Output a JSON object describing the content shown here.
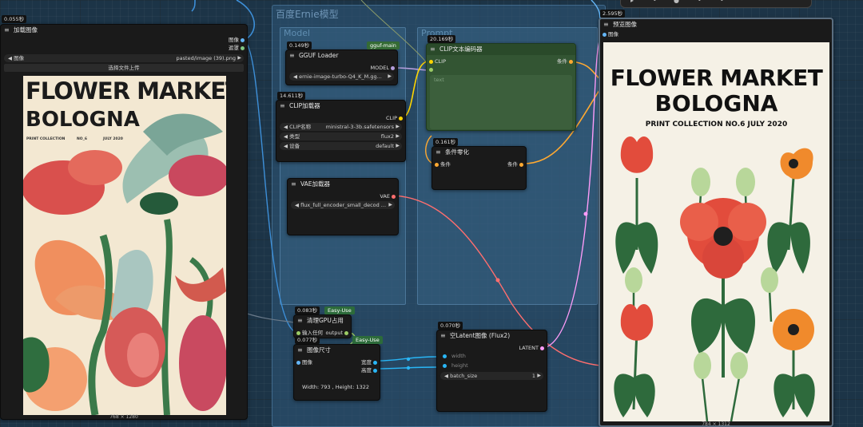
{
  "toolbar": {
    "icons": [
      "cursor-icon",
      "dot-icon",
      "gear-icon",
      "hand-icon"
    ]
  },
  "groups": {
    "main_title": "百度Ernie模型",
    "model_title": "Model",
    "prompt_title": "Prompt"
  },
  "load_image": {
    "timing": "0.055秒",
    "title": "加载图像",
    "out_image": "图像",
    "out_mask": "遮罩",
    "image_label": "图像",
    "image_value": "pasted/image (39).png",
    "upload_label": "选择文件上传",
    "size_caption": "768 × 1280"
  },
  "gguf_loader": {
    "timing": "0.149秒",
    "badge": "gguf-main",
    "title": "GGUF Loader",
    "out_model": "MODEL",
    "model_value": "ernie-image-turbo-Q4_K_M.gg..."
  },
  "clip_loader": {
    "timing": "14.611秒",
    "title": "CLIP加载器",
    "out_clip": "CLIP",
    "clip_name_label": "CLIP名称",
    "clip_name_value": "ministral-3-3b.safetensors",
    "type_label": "类型",
    "type_value": "flux2",
    "device_label": "设备",
    "device_value": "default"
  },
  "vae_loader": {
    "title": "VAE加载器",
    "out_vae": "VAE",
    "vae_value": "flux_full_encoder_small_decod ..."
  },
  "clip_encode": {
    "timing": "20.169秒",
    "title": "CLIP文本编码器",
    "in_clip": "CLIP",
    "out_cond": "条件",
    "text_placeholder": "text"
  },
  "cond_zero": {
    "timing": "0.161秒",
    "title": "条件零化",
    "in_cond": "条件",
    "out_cond": "条件"
  },
  "gpu_clean": {
    "timing": "0.083秒",
    "badge": "Easy-Use",
    "title": "清理GPU占用",
    "in_any": "输入任何",
    "out_output": "output"
  },
  "image_size": {
    "timing": "0.077秒",
    "badge": "Easy-Use",
    "title": "图像尺寸",
    "in_image": "图像",
    "out_width": "宽度",
    "out_height": "高度",
    "result": "Width: 793 , Height: 1322"
  },
  "empty_latent": {
    "timing": "0.070秒",
    "title": "空Latent图像 (Flux2)",
    "out_latent": "LATENT",
    "width_label": "width",
    "height_label": "height",
    "batch_label": "batch_size",
    "batch_value": "1"
  },
  "preview": {
    "timing": "2.595秒",
    "title": "预览图像",
    "in_image": "图像",
    "size_caption": "784 × 1312"
  },
  "poster_left": {
    "line1": "FLOWER MARKET",
    "line2": "BOLOGNA",
    "meta1": "PRINT COLLECTION",
    "meta2": "NO_6",
    "meta3": "JULY 2020"
  },
  "poster_right": {
    "line1": "FLOWER MARKET",
    "line2": "BOLOGNA",
    "line3": "PRINT COLLECTION NO.6 JULY 2020"
  },
  "colors": {
    "image_port": "#64b5f6",
    "mask_port": "#81c784",
    "model_port": "#b39ddb",
    "clip_port": "#ffd500",
    "cond_port": "#ffa931",
    "vae_port": "#ff6e6e",
    "latent_port": "#ff9cf9",
    "int_port": "#29b6f6",
    "any_port": "#9ccc65",
    "prompt_node": "#335533"
  }
}
